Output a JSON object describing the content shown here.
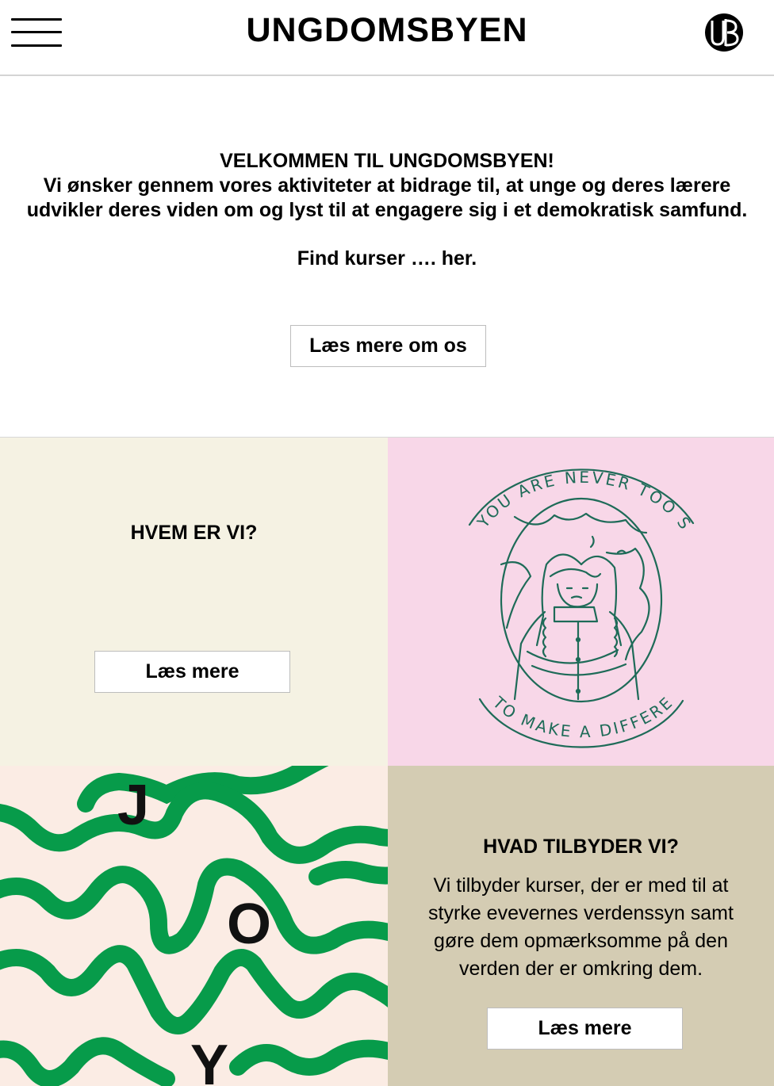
{
  "header": {
    "title": "UNGDOMSBYEN",
    "menu_icon": "hamburger-menu-icon",
    "logo_icon": "ub-logo"
  },
  "intro": {
    "heading": "VELKOMMEN TIL UNGDOMSBYEN!",
    "line1": "Vi ønsker gennem vores aktiviteter at bidrage til, at unge og deres lærere",
    "line2": "udvikler deres viden om og lyst til at engagere sig i et demokratisk samfund.",
    "find_courses": "Find kurser …. her.",
    "button_label": "Læs mere om os"
  },
  "who": {
    "heading": "HVEM ER VI?",
    "button_label": "Læs mere"
  },
  "illustration": {
    "top_text": "YOU ARE NEVER TOO SMALL",
    "bottom_text": "TO MAKE A DIFFERENCE",
    "line_color": "#1e6b58"
  },
  "joy": {
    "letters": [
      "J",
      "O",
      "Y"
    ],
    "wave_color": "#079b4a"
  },
  "offer": {
    "heading": "HVAD TILBYDER VI?",
    "line1": "Vi tilbyder kurser, der er med til at",
    "line2": "styrke evevernes verdenssyn samt",
    "line3": "gøre dem opmærksomme på den",
    "line4": "verden der er omkring dem.",
    "button_label": "Læs mere"
  },
  "colors": {
    "who_bg": "#f5f2e3",
    "greta_bg": "#f8d7e8",
    "joy_bg": "#fbece4",
    "offer_bg": "#d4ccb3"
  }
}
